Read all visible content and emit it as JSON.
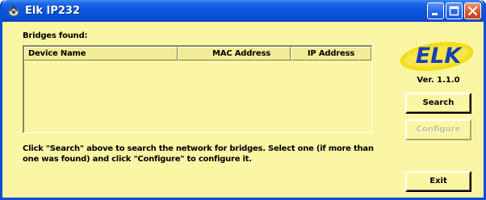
{
  "window": {
    "title": "Elk IP232",
    "controls": {
      "minimize_icon": "minimize-icon",
      "maximize_icon": "maximize-icon",
      "close_icon": "close-icon"
    }
  },
  "bridges": {
    "label": "Bridges found:",
    "columns": [
      "Device Name",
      "MAC Address",
      "IP Address"
    ],
    "rows": []
  },
  "instructions": "Click \"Search\" above to search the network for bridges.  Select one (if more than one was found) and click \"Configure\" to configure it.",
  "brand": {
    "logo_text": "ELK",
    "version": "Ver. 1.1.0"
  },
  "buttons": {
    "search": "Search",
    "configure": "Configure",
    "exit": "Exit"
  },
  "colors": {
    "background": "#fbf6a4",
    "titlebar": "#0955de",
    "logo_blue": "#1a3db8",
    "logo_swoosh": "#f2de1a",
    "disabled_text": "#c9c48b"
  }
}
